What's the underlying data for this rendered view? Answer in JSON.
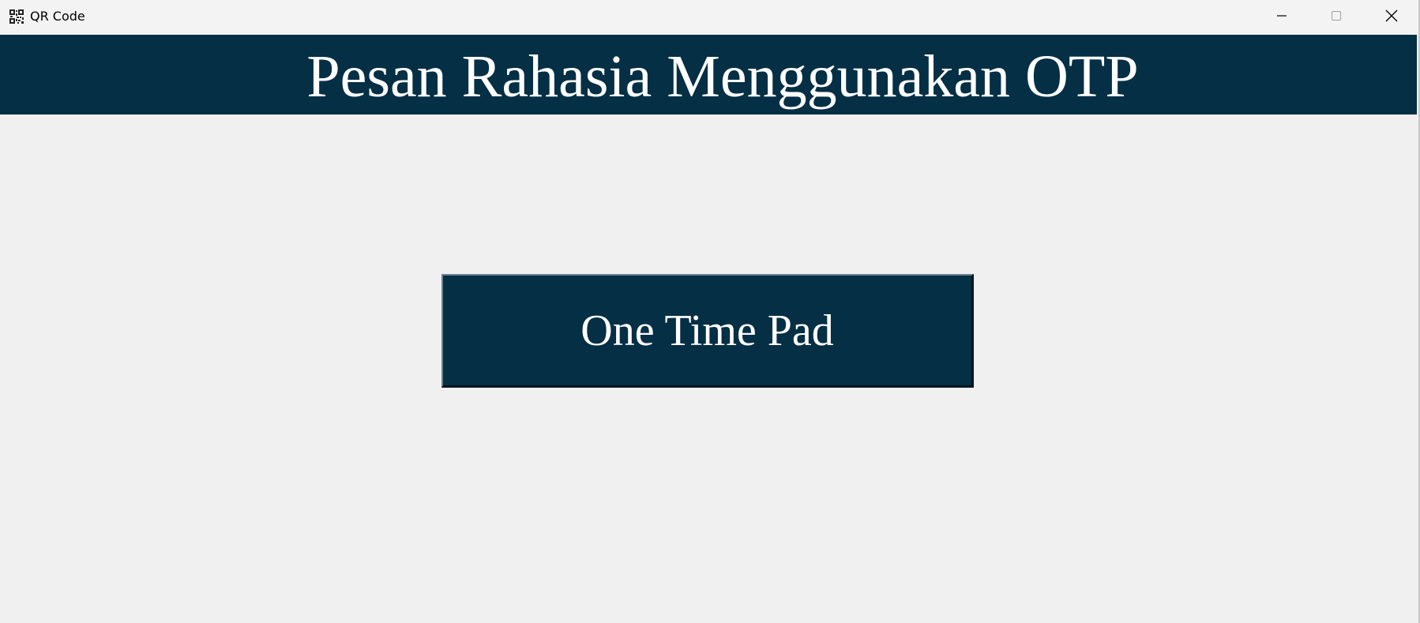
{
  "window": {
    "title": "QR Code",
    "icon": "qr-code-icon",
    "controls": {
      "minimize_icon": "minimize-icon",
      "maximize_icon": "maximize-icon",
      "close_icon": "close-icon"
    }
  },
  "header": {
    "title": "Pesan Rahasia Menggunakan OTP",
    "background_color": "#052f45",
    "text_color": "#ffffff"
  },
  "main": {
    "otp_button_label": "One Time Pad",
    "background_color": "#f0f0f0"
  }
}
